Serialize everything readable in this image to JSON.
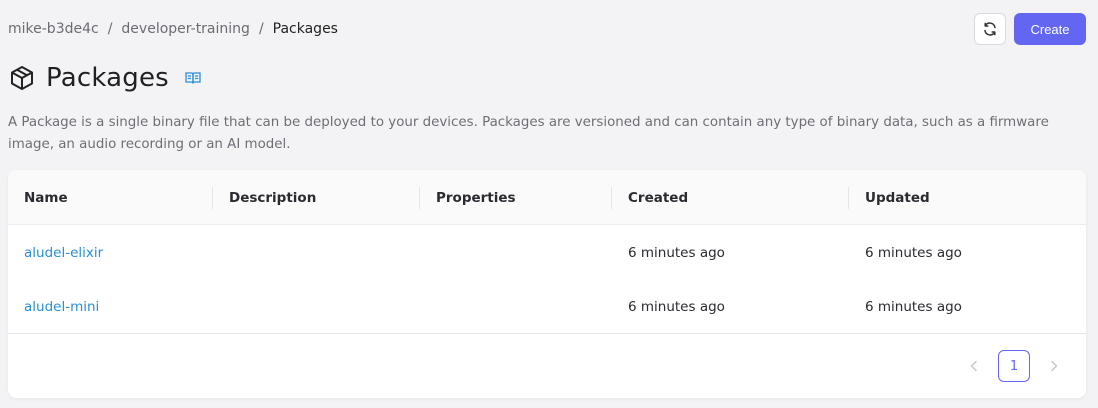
{
  "breadcrumb": {
    "items": [
      "mike-b3de4c",
      "developer-training",
      "Packages"
    ],
    "separator": "/"
  },
  "toolbar": {
    "refresh_icon": "refresh-icon",
    "create_label": "Create",
    "accent_color": "#6366f1"
  },
  "page": {
    "title": "Packages",
    "title_icon": "package-box-icon",
    "docs_icon": "open-book-icon",
    "description": "A Package is a single binary file that can be deployed to your devices. Packages are versioned and can contain any type of binary data, such as a firmware image, an audio recording or an AI model."
  },
  "table": {
    "columns": [
      "Name",
      "Description",
      "Properties",
      "Created",
      "Updated"
    ],
    "rows": [
      {
        "name": "aludel-elixir",
        "description": "",
        "properties": "",
        "created": "6 minutes ago",
        "updated": "6 minutes ago"
      },
      {
        "name": "aludel-mini",
        "description": "",
        "properties": "",
        "created": "6 minutes ago",
        "updated": "6 minutes ago"
      }
    ],
    "link_color": "#2a8fd6"
  },
  "pagination": {
    "current_page": "1",
    "prev_icon": "chevron-left-icon",
    "next_icon": "chevron-right-icon"
  }
}
